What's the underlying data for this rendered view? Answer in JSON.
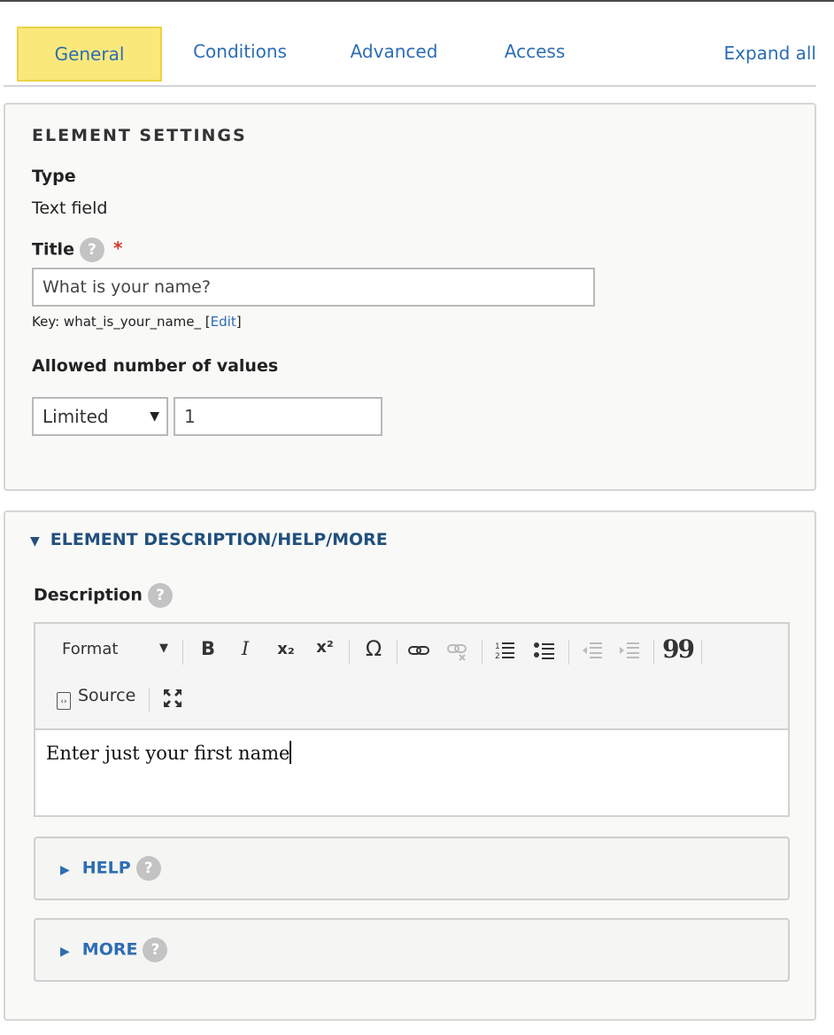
{
  "tabs": {
    "general": "General",
    "conditions": "Conditions",
    "advanced": "Advanced",
    "access": "Access",
    "expand_all": "Expand all"
  },
  "element_settings": {
    "heading": "ELEMENT SETTINGS",
    "type_label": "Type",
    "type_value": "Text field",
    "title_label": "Title",
    "title_required": "*",
    "title_value": "What is your name?",
    "key_prefix": "Key: what_is_your_name_ ",
    "key_edit_open": "[",
    "key_edit": "Edit",
    "key_edit_close": "]",
    "allowed_label": "Allowed number of values",
    "allowed_select": "Limited",
    "allowed_count": "1"
  },
  "description_panel": {
    "summary": "ELEMENT DESCRIPTION/HELP/MORE",
    "description_label": "Description",
    "toolbar": {
      "format": "Format",
      "bold": "B",
      "italic": "I",
      "subscript": "x₂",
      "superscript": "x²",
      "special_char": "Ω",
      "blockquote": "99",
      "source": "Source"
    },
    "editor_text": "Enter just your first name",
    "help_summary": "HELP",
    "more_summary": "MORE"
  },
  "help_glyph": "?",
  "colors": {
    "accent": "#2d6db3",
    "active_tab": "#fbe87b",
    "required": "#d33a2c"
  }
}
